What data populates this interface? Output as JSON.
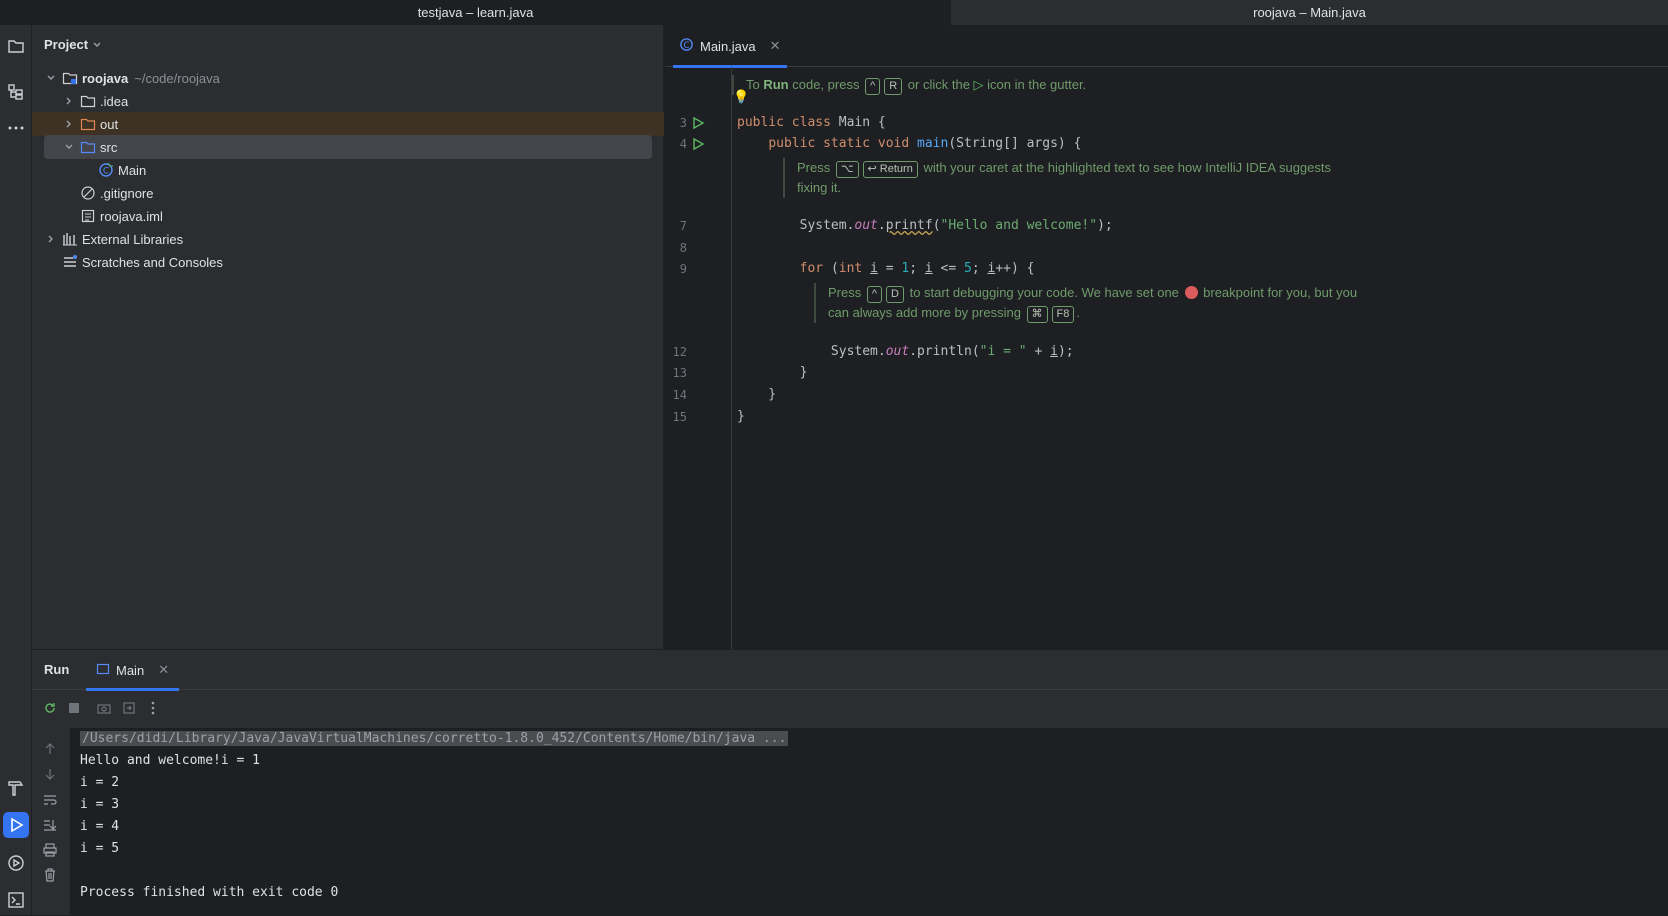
{
  "window_tabs": [
    "testjava – learn.java",
    "roojava – Main.java"
  ],
  "project": {
    "title": "Project",
    "tree": [
      {
        "label": "roojava",
        "hint": "~/code/roojava"
      },
      {
        "label": ".idea"
      },
      {
        "label": "out"
      },
      {
        "label": "src"
      },
      {
        "label": "Main"
      },
      {
        "label": ".gitignore"
      },
      {
        "label": "roojava.iml"
      },
      {
        "label": "External Libraries"
      },
      {
        "label": "Scratches and Consoles"
      }
    ]
  },
  "editor": {
    "tab": "Main.java",
    "hint1": {
      "pre": "To ",
      "run": "Run",
      "mid": " code, press ",
      "k1": "^",
      "k2": "R",
      "post1": " or click the ",
      "post2": " icon in the gutter."
    },
    "hint2": {
      "pre": "Press ",
      "k1": "⌥",
      "k2": "↩ Return",
      "post": " with your caret at the highlighted text to see how IntelliJ IDEA suggests",
      "line2": "fixing it."
    },
    "hint3": {
      "pre": "Press ",
      "k1": "^",
      "k2": "D",
      "mid": " to start debugging your code. We have set one ",
      "post": " breakpoint for you, but you",
      "line2pre": "can always add more by pressing ",
      "k3": "⌘",
      "k4": "F8",
      "line2post": "."
    },
    "line_numbers": {
      "l3": "3",
      "l4": "4",
      "l7": "7",
      "l8": "8",
      "l9": "9",
      "l12": "12",
      "l13": "13",
      "l14": "14",
      "l15": "15"
    }
  },
  "run": {
    "title": "Run",
    "tab": "Main",
    "console": [
      "/Users/didi/Library/Java/JavaVirtualMachines/corretto-1.8.0_452/Contents/Home/bin/java ...",
      "Hello and welcome!i = 1",
      "i = 2",
      "i = 3",
      "i = 4",
      "i = 5",
      "",
      "Process finished with exit code 0"
    ]
  }
}
